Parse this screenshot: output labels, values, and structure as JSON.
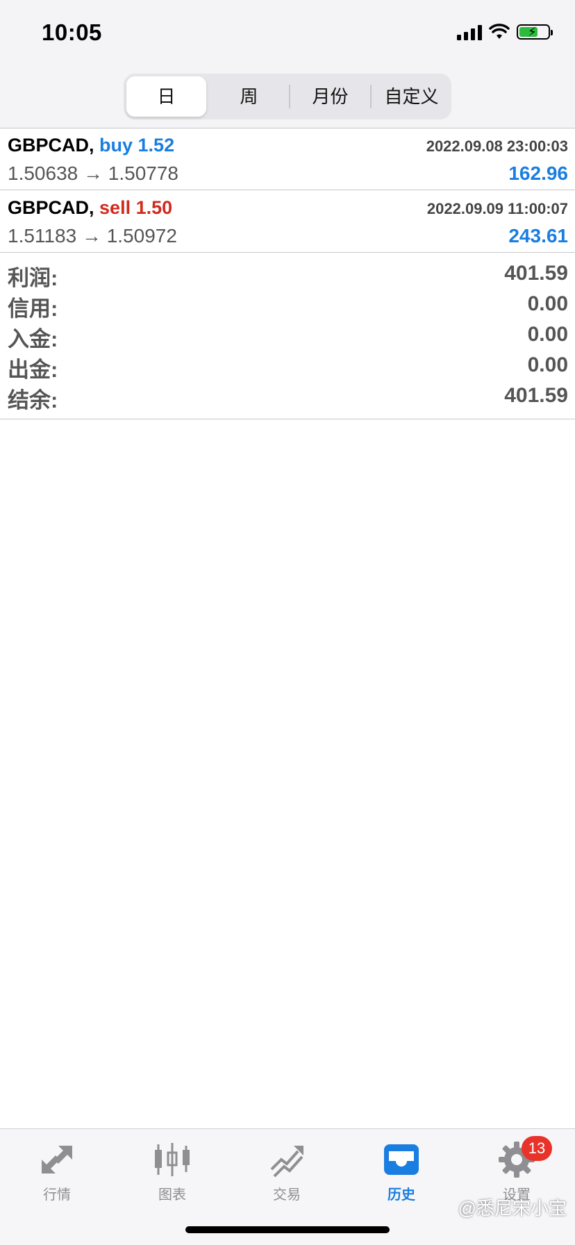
{
  "status_bar": {
    "time": "10:05"
  },
  "period_tabs": [
    {
      "label": "日",
      "active": true
    },
    {
      "label": "周",
      "active": false
    },
    {
      "label": "月份",
      "active": false
    },
    {
      "label": "自定义",
      "active": false
    }
  ],
  "deals": [
    {
      "symbol": "GBPCAD,",
      "side": "buy",
      "volume": "1.52",
      "side_label": "buy 1.52",
      "datetime": "2022.09.08 23:00:03",
      "prices": "1.50638 → 1.50778",
      "profit": "162.96"
    },
    {
      "symbol": "GBPCAD,",
      "side": "sell",
      "volume": "1.50",
      "side_label": "sell 1.50",
      "datetime": "2022.09.09 11:00:07",
      "prices": "1.51183 → 1.50972",
      "profit": "243.61"
    }
  ],
  "summary": [
    {
      "label": "利润:",
      "value": "401.59"
    },
    {
      "label": "信用:",
      "value": "0.00"
    },
    {
      "label": "入金:",
      "value": "0.00"
    },
    {
      "label": "出金:",
      "value": "0.00"
    },
    {
      "label": "结余:",
      "value": "401.59"
    }
  ],
  "tab_bar": [
    {
      "label": "行情",
      "icon": "quotes-arrows-icon",
      "active": false
    },
    {
      "label": "图表",
      "icon": "candlestick-chart-icon",
      "active": false
    },
    {
      "label": "交易",
      "icon": "trade-trend-icon",
      "active": false
    },
    {
      "label": "历史",
      "icon": "history-inbox-icon",
      "active": true
    },
    {
      "label": "设置",
      "icon": "gear-icon",
      "active": false,
      "badge": "13"
    }
  ],
  "watermark": "@悉尼宋小宝",
  "colors": {
    "buy": "#1a7ee0",
    "sell": "#d12a1f",
    "accent": "#1a7ee0",
    "badge": "#e8332a"
  }
}
